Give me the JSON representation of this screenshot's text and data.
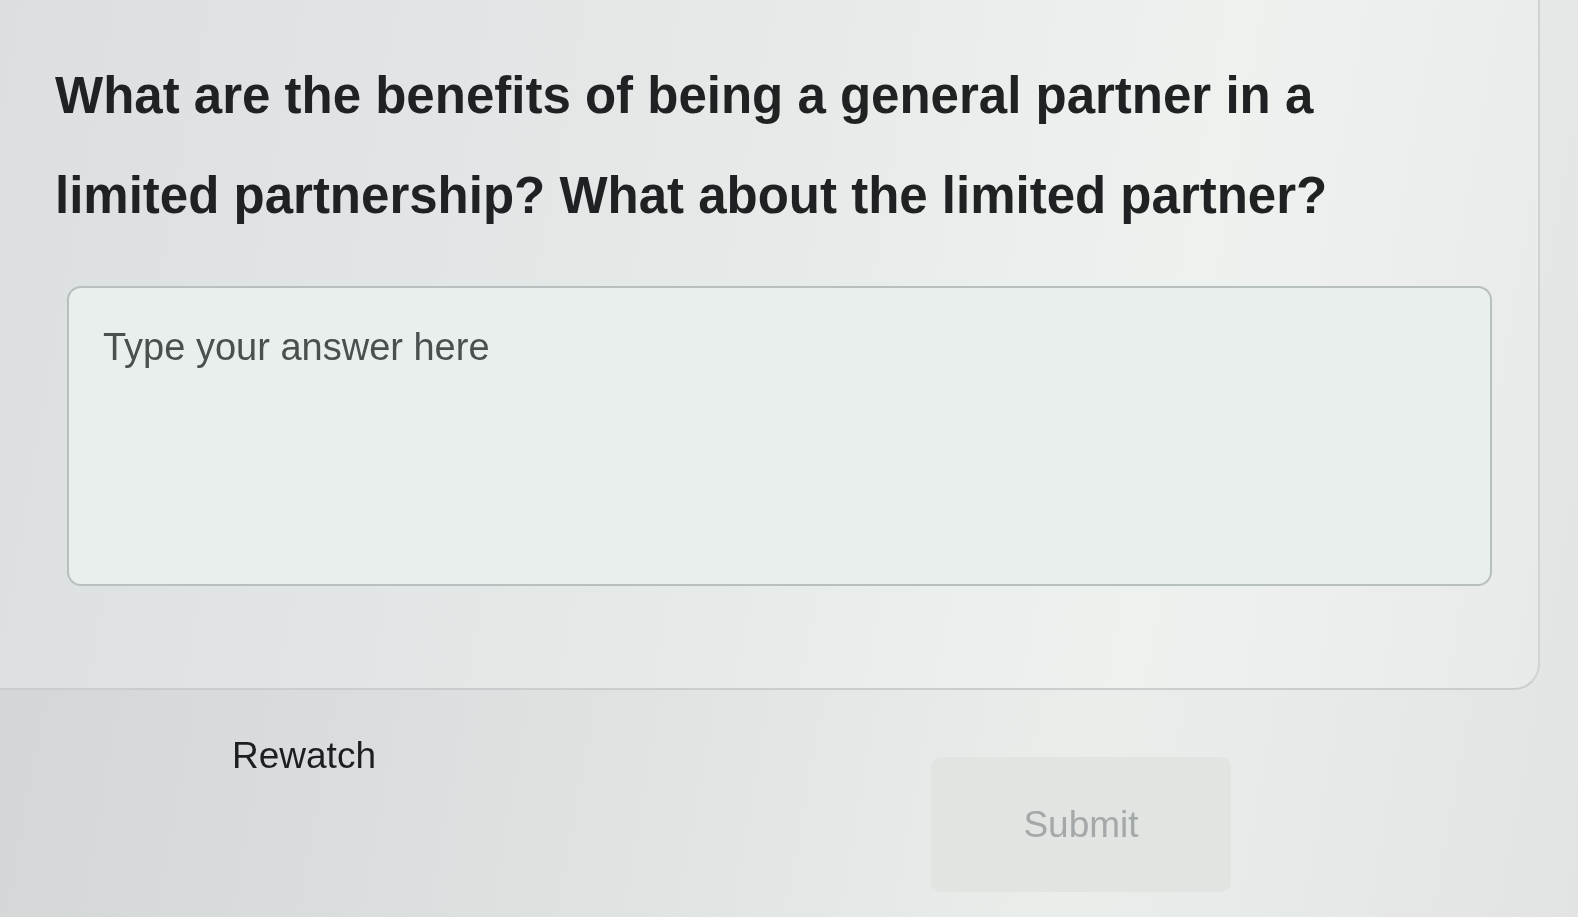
{
  "question": {
    "text": "What are the benefits of being a general partner in a limited partnership? What about the limited partner?"
  },
  "answer": {
    "placeholder": "Type your answer here"
  },
  "actions": [
    {
      "label": "Rewatch",
      "kind": "link",
      "disabled": false
    },
    {
      "label": "Submit",
      "kind": "button",
      "disabled": true
    }
  ]
}
